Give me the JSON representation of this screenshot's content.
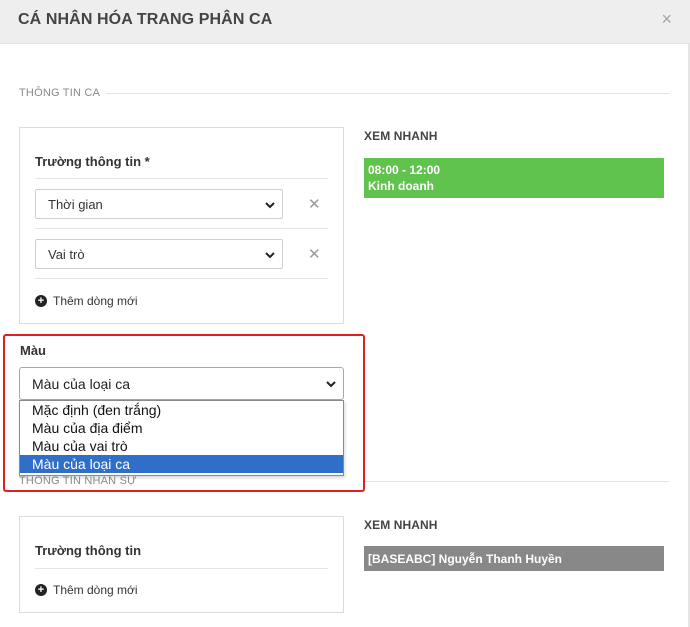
{
  "modal": {
    "title": "CÁ NHÂN HÓA TRANG PHÂN CA",
    "close": "×"
  },
  "section1": {
    "title": "THÔNG TIN CA",
    "fields_label": "Trường thông tin *",
    "rows": [
      {
        "value": "Thời gian",
        "remove": "✕"
      },
      {
        "value": "Vai trò",
        "remove": "✕"
      }
    ],
    "add_row": "Thêm dòng mới",
    "preview": {
      "title": "XEM NHANH",
      "line1": "08:00 - 12:00",
      "line2": "Kinh doanh",
      "color": "#5fc34e"
    }
  },
  "color_field": {
    "label": "Màu",
    "value": "Màu của loại ca",
    "options": [
      "Mặc định (đen trắng)",
      "Màu của địa điểm",
      "Màu của vai trò",
      "Màu của loại ca"
    ],
    "selected_index": 3
  },
  "section2": {
    "title": "THÔNG TIN NHÂN SỰ",
    "fields_label": "Trường thông tin",
    "add_row": "Thêm dòng mới",
    "preview": {
      "title": "XEM NHANH",
      "line1": "[BASEABC] Nguyễn Thanh Huyền",
      "color": "#888888"
    }
  },
  "colors": {
    "highlight": "#e02020",
    "selected_option": "#2f6ec9"
  }
}
